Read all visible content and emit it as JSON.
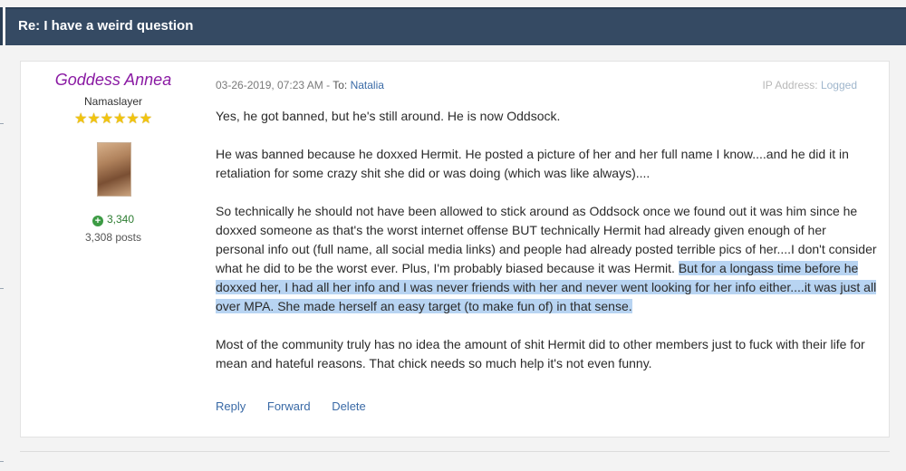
{
  "thread": {
    "title": "Re: I have a weird question"
  },
  "author": {
    "name": "Goddess Annea",
    "rank": "Namaslayer",
    "stars": "★★★★★★",
    "reputation": "3,340",
    "posts": "3,308 posts"
  },
  "post": {
    "date": "03-26-2019, 07:23 AM",
    "separator": " - ",
    "to_label": "To:",
    "to_user": "Natalia",
    "ip_label": "IP Address:",
    "ip_value": "Logged",
    "p1": "Yes, he got banned, but he's still around. He is now Oddsock.",
    "p2": "He was banned because he doxxed Hermit. He posted a picture of her and her full name I know....and he did it in retaliation for some crazy shit she did or was doing (which was like always)....",
    "p3_normal": "So technically he should not have been allowed to stick around as Oddsock once we found out it was him since he doxxed someone as that's the worst internet offense BUT technically Hermit had already given enough of her personal info out (full name, all social media links) and people had already posted terrible pics of her....I don't consider what he did to be the worst ever. Plus, I'm probably biased because it was Hermit. ",
    "p3_highlight": "But for a longass time before he doxxed her, I had all her info and I was never friends with her and never went looking for her info either....it was just all over MPA. She made herself an easy target (to make fun of) in that sense.",
    "p4": "Most of the community truly has no idea the amount of shit Hermit did to other members just to fuck with their life for mean and hateful reasons. That chick needs so much help it's not even funny."
  },
  "actions": {
    "reply": "Reply",
    "forward": "Forward",
    "delete": "Delete"
  },
  "colors": {
    "header_bg": "#354a63",
    "author": "#8a1aa3",
    "link": "#3a6aa6",
    "highlight": "#b8d4f2"
  }
}
